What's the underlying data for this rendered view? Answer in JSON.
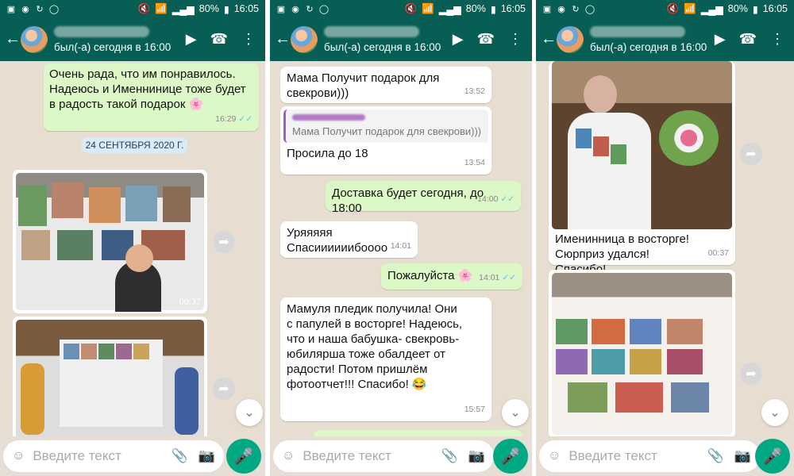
{
  "status": {
    "battery": "80%",
    "time": "16:05"
  },
  "chat": {
    "status": "был(-а) сегодня в 16:00"
  },
  "composer": {
    "placeholder": "Введите текст"
  },
  "panel1": {
    "msg1": "Очень рада, что им понравилось. Надеюсь и Именнинице тоже будет в радость такой подарок 🌸",
    "msg1_time": "16:29",
    "date": "24 СЕНТЯБРЯ 2020 Г.",
    "video1_time": "00:37"
  },
  "panel2": {
    "msg1": "Мама Получит подарок для свекрови)))",
    "msg1_time": "13:52",
    "quote": "Мама Получит подарок для свекрови)))",
    "msg2": "Просила до 18",
    "msg2_time": "13:54",
    "msg3": "Доставка будет сегодня, до 18:00",
    "msg3_time": "14:00",
    "msg4": "Уряяяяя Спасиииииибоооо",
    "msg4_time": "14:01",
    "msg5": "Пожалуйста 🌸",
    "msg5_time": "14:01",
    "msg6": "Мамуля пледик получила! Они с папулей в восторге! Надеюсь, что и наша бабушка- свекровь-юбилярша тоже обалдеет от радости! Потом пришлём фотоотчет!!! Спасибо! 😂",
    "msg6_time": "15:57"
  },
  "panel3": {
    "msg1": "Именинница в восторге! Сюрприз удался! Спасибо!",
    "msg1_time": "00:37"
  }
}
